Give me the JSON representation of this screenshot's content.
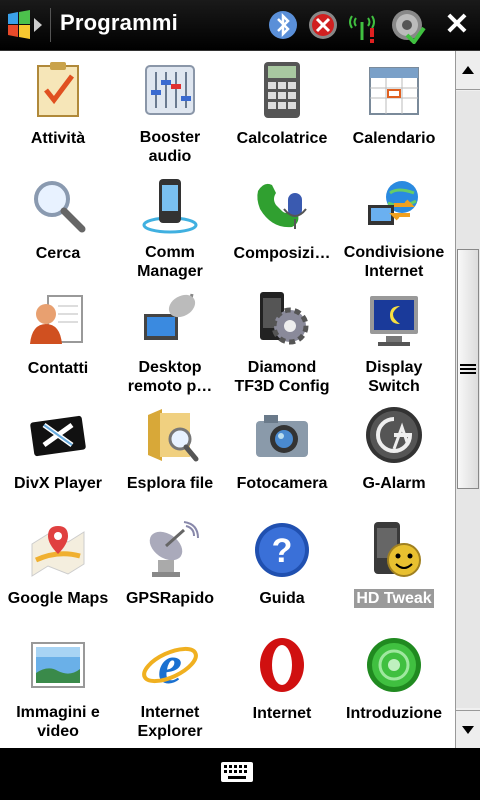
{
  "titlebar": {
    "title": "Programmi",
    "start_icon": "windows-start-icon",
    "status_icons": [
      "bluetooth-icon",
      "connection-error-icon",
      "signal-icon",
      "volume-icon"
    ],
    "close_label": "✕"
  },
  "programs": [
    {
      "label": "Attività",
      "icon": "tasks-icon"
    },
    {
      "label": "Booster\naudio",
      "icon": "audio-booster-icon"
    },
    {
      "label": "Calcolatrice",
      "icon": "calculator-icon"
    },
    {
      "label": "Calendario",
      "icon": "calendar-icon"
    },
    {
      "label": "Cerca",
      "icon": "search-icon"
    },
    {
      "label": "Comm\nManager",
      "icon": "comm-manager-icon"
    },
    {
      "label": "Composizi…",
      "icon": "voice-dial-icon"
    },
    {
      "label": "Condivisione\nInternet",
      "icon": "internet-sharing-icon"
    },
    {
      "label": "Contatti",
      "icon": "contacts-icon"
    },
    {
      "label": "Desktop\nremoto p…",
      "icon": "remote-desktop-icon"
    },
    {
      "label": "Diamond\nTF3D Config",
      "icon": "tf3d-config-icon"
    },
    {
      "label": "Display\nSwitch",
      "icon": "display-switch-icon"
    },
    {
      "label": "DivX Player",
      "icon": "divx-player-icon"
    },
    {
      "label": "Esplora file",
      "icon": "file-explorer-icon"
    },
    {
      "label": "Fotocamera",
      "icon": "camera-icon"
    },
    {
      "label": "G-Alarm",
      "icon": "g-alarm-icon"
    },
    {
      "label": "Google Maps",
      "icon": "google-maps-icon"
    },
    {
      "label": "GPSRapido",
      "icon": "gps-icon"
    },
    {
      "label": "Guida",
      "icon": "help-icon"
    },
    {
      "label": "HD Tweak",
      "icon": "hd-tweak-icon",
      "selected": true
    },
    {
      "label": "Immagini e\nvideo",
      "icon": "pictures-videos-icon"
    },
    {
      "label": "Internet\nExplorer",
      "icon": "internet-explorer-icon"
    },
    {
      "label": "Internet",
      "icon": "opera-icon"
    },
    {
      "label": "Introduzione",
      "icon": "getting-started-icon"
    }
  ],
  "scrollbar": {
    "position": 0.42
  },
  "bottombar": {
    "icon": "keyboard-icon"
  }
}
